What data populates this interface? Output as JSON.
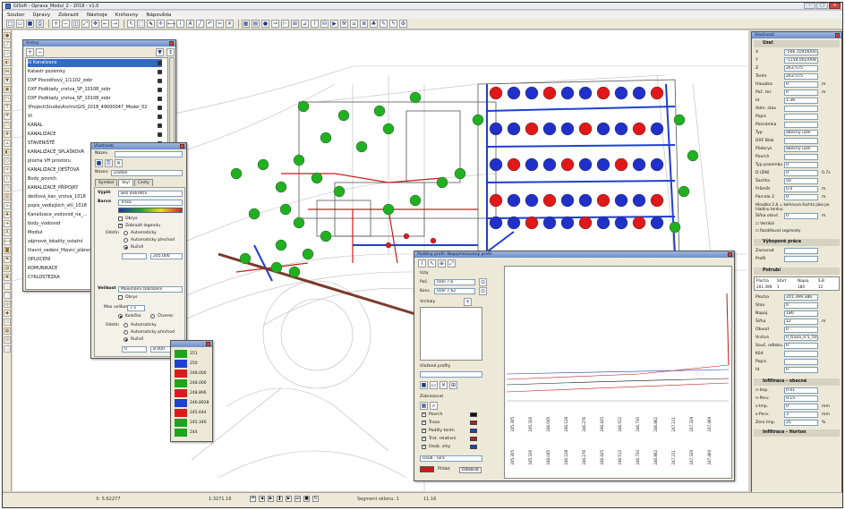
{
  "window": {
    "title": "GISoft - Oprava_Modul_2 - 2018 - v1.0"
  },
  "menu": [
    "Soubor",
    "Úpravy",
    "Zobrazit",
    "Nástroje",
    "Knihovny",
    "Nápověda"
  ],
  "layers": {
    "title": "Vrstvy",
    "items": [
      "Kanalizace",
      "Katastr pozemky",
      "DXF Povodňový_1/1102_zobr",
      "DXF Podklady_vrstva_SF_10108_zobr",
      "DXF Podklady_vrstva_SF_10108_zobr",
      "\\Project\\Studie\\Archiv\\GIS_2018_49000047_Model_02",
      "VI",
      "KANÁL",
      "KANALIZACE",
      "STAVENIŠTĚ",
      "KANALIZACE_SPLAŠKOVÁ",
      "plocha VH prostoru",
      "KANALIZACE_DEŠŤOVÁ",
      "Body_povrch",
      "KANALIZACE_PŘÍPOJKY",
      "dešťová_kan_vrstva_1018",
      "popis_vedlejších_sítí_1018",
      "Kanalizace_vodovod_na_...",
      "body_vodovod",
      "Modiul",
      "zájmové_lokality_ostatní",
      "hlavní_vedení_Hlavní_plánování",
      "OPLOCENÍ",
      "KOMUNIKACE",
      "CYKLOSTEZKA"
    ]
  },
  "style_dialog": {
    "title": "Vlastnosti",
    "tabs": [
      "Symbol",
      "Styl",
      "Cesty"
    ],
    "name_label": "Název",
    "name_value": "Zadání",
    "fill_label": "Výplň",
    "fill_value": "Bez diskrétní",
    "color_label": "Barva",
    "color_value": "Trasa",
    "opt_outline": "Obrys",
    "opt_legend": "Zobrazit legendu",
    "group_label": "Odstín",
    "opt_auto": "Automaticky",
    "opt_auto_grad": "Automaticky přechod",
    "opt_manual": "Ručně",
    "manual_value": "205.000",
    "size_label": "Velikost",
    "size_value": "Maximální zobrazení",
    "opt_outline2": "Obrys",
    "max_label": "Max velikost",
    "max_value": "7.5",
    "opt_circle": "Kolečko",
    "opt_square": "Čtverec",
    "group2_label": "Odstín",
    "val_from": "0",
    "val_to": "8.000"
  },
  "legend": {
    "items": [
      {
        "value": "251",
        "color": "#1fa31f"
      },
      {
        "value": "250",
        "color": "#2040d0"
      },
      {
        "value": "248.000",
        "color": "#d81c1c"
      },
      {
        "value": "248.000",
        "color": "#1fa31f"
      },
      {
        "value": "248.896",
        "color": "#d81c1c"
      },
      {
        "value": "246.8928",
        "color": "#2040d0"
      },
      {
        "value": "245.644",
        "color": "#d81c1c"
      },
      {
        "value": "245.346",
        "color": "#1fa31f"
      },
      {
        "value": "244",
        "color": "#1fa31f"
      }
    ]
  },
  "profile": {
    "title": "Podélný profil: Nepojmenovaný profil",
    "group_label": "Uzly",
    "from_label": "Poč.",
    "from_value": "Uzel 7.6",
    "to_label": "Konc.",
    "to_value": "Uzel 7.62",
    "vertices_label": "Vrcholy",
    "sub_label": "Uložené profily",
    "display_label": "Zobrazovat",
    "items": [
      {
        "label": "Povrch",
        "color": "#111111"
      },
      {
        "label": "Trasa",
        "color": "#c41818"
      },
      {
        "label": "Podély terén",
        "color": "#2040c0"
      },
      {
        "label": "Trat. relativní",
        "color": "#c41818"
      },
      {
        "label": "Osob. vlny",
        "color": "#2040c0"
      }
    ],
    "mode_label": "Osob - Šíra",
    "add_label": "Přidat",
    "remove_label": "Odebrat",
    "ticks": [
      "245.305",
      "245.326",
      "246.045",
      "246.128",
      "246.276",
      "246.425",
      "246.512",
      "246.730",
      "246.862",
      "247.211",
      "247.329",
      "247.469"
    ]
  },
  "props": {
    "title": "Vlastnosti",
    "object_label": "Uzel",
    "rows": [
      {
        "k": "X",
        "v": "-566.10456/001",
        "u": ""
      },
      {
        "k": "Y",
        "v": "-1158.002/008",
        "u": ""
      },
      {
        "k": "Z",
        "v": "263.575",
        "u": ""
      },
      {
        "k": "Terén",
        "v": "263.575",
        "u": ""
      },
      {
        "k": "Hloubka",
        "v": "0",
        "u": "m"
      },
      {
        "k": "Poč. ter.",
        "v": "0",
        "u": "m"
      },
      {
        "k": "Id",
        "v": "1.36",
        "u": ""
      },
      {
        "k": "Adm. stav",
        "v": "",
        "u": ""
      },
      {
        "k": "Popis",
        "v": "",
        "u": ""
      },
      {
        "k": "Poznámka",
        "v": "",
        "u": ""
      },
      {
        "k": "Typ",
        "v": "obecný uzel",
        "u": ""
      },
      {
        "k": "DXF Blok",
        "v": "",
        "u": ""
      },
      {
        "k": "Půdorys",
        "v": "obecný uzel",
        "u": ""
      },
      {
        "k": "Povrch",
        "v": "",
        "u": ""
      },
      {
        "k": "Typ pozemku",
        "v": "0",
        "u": ""
      },
      {
        "k": "D (DN)",
        "v": "0",
        "u": "0.7s"
      },
      {
        "k": "Šachta",
        "v": "50",
        "u": ""
      },
      {
        "k": "Průměr",
        "v": "0.0",
        "u": "m"
      },
      {
        "k": "Parcela 2",
        "v": "0",
        "u": "m"
      }
    ],
    "note": "Hloubka 2 Δ = kořenová šachta jako po hladinu terénu",
    "rows2": [
      {
        "k": "Šířka otevř.",
        "v": "0",
        "u": "m"
      }
    ],
    "opt_vertical": "Vertikál",
    "opt_segments": "Rozdělovat segmenty",
    "section_out": "Výkopové práce",
    "out_rows": [
      {
        "k": "Zarovnat",
        "v": "",
        "u": ""
      },
      {
        "k": "Profil",
        "v": "",
        "u": ""
      }
    ],
    "section_pipe": "Potrubí",
    "pipe_header": [
      "Plocha",
      "Start",
      "Napoj.",
      "Š.B"
    ],
    "pipe_values": [
      "201.399",
      "1",
      "180",
      "12"
    ],
    "pipe_rows": [
      {
        "k": "Plocha",
        "v": "201.399.386",
        "u": ""
      },
      {
        "k": "Stav",
        "v": "0",
        "u": ""
      },
      {
        "k": "Napoj.",
        "v": "180",
        "u": ""
      },
      {
        "k": "Šířka",
        "v": "12",
        "u": "m"
      },
      {
        "k": "Obvod",
        "v": "0",
        "u": ""
      },
      {
        "k": "Vrstva",
        "v": "0_trasa_0.5_50_ve...",
        "u": ""
      },
      {
        "k": "Souč. odtoku",
        "v": "0",
        "u": ""
      },
      {
        "k": "Kód",
        "v": "",
        "u": ""
      },
      {
        "k": "Popis",
        "v": "",
        "u": ""
      },
      {
        "k": "Id",
        "v": "0",
        "u": ""
      }
    ],
    "section_infil": "Infiltrace - obecné",
    "infil_rows": [
      {
        "k": "n-Imp.",
        "v": "0.01",
        "u": ""
      },
      {
        "k": "n-Perv.",
        "v": "0.15",
        "u": ""
      },
      {
        "k": "s-Imp.",
        "v": "0",
        "u": "mm"
      },
      {
        "k": "s-Perv.",
        "v": "3",
        "u": "mm"
      },
      {
        "k": "Zero Imp.",
        "v": "25",
        "u": "%"
      }
    ],
    "section_infil2": "Infiltrace - Horton"
  },
  "status": {
    "coords": "X: 5.62277",
    "zoom": "1:3271.16",
    "scale": "Segment sklonu: 1",
    "page": "11.16"
  }
}
